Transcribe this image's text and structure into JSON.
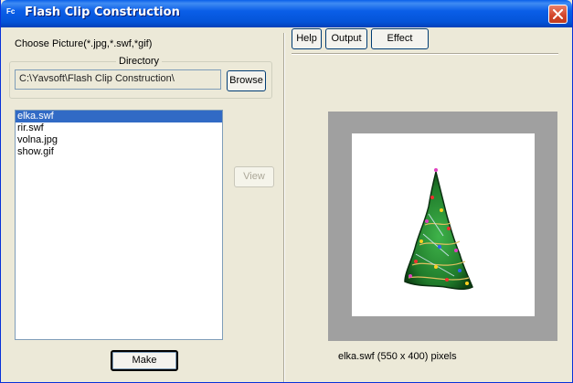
{
  "window": {
    "title": "Flash Clip Construction",
    "icon_text": "Fc"
  },
  "left": {
    "choose_label": "Choose Picture(*.jpg,*.swf,*gif)",
    "directory_legend": "Directory",
    "directory_value": "C:\\Yavsoft\\Flash Clip Construction\\",
    "browse_label": "Browse",
    "files": [
      "elka.swf",
      "rir.swf",
      "volna.jpg",
      "show.gif"
    ],
    "selected_file": "elka.swf",
    "view_label": "View",
    "make_label": "Make"
  },
  "toolbar": {
    "help_label": "Help",
    "output_label": "Output",
    "effect_label": "Effect"
  },
  "preview": {
    "caption": "elka.swf (550 x 400) pixels",
    "image_subject": "christmas-tree"
  },
  "colors": {
    "titlebar": "#0454d8",
    "window_bg": "#ece9d8",
    "selection": "#316ac5",
    "preview_frame": "#a0a0a0",
    "close_button": "#d2442a"
  }
}
